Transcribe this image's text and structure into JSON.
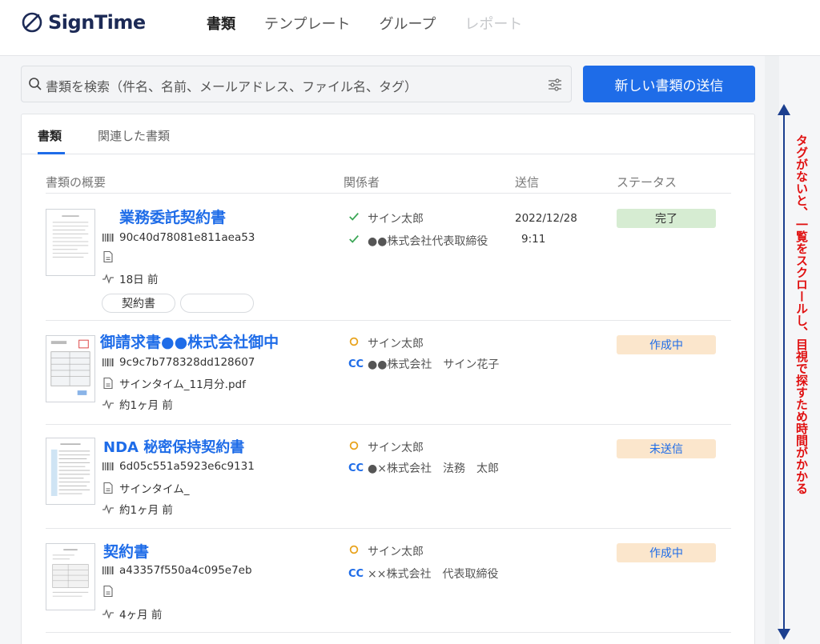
{
  "app": {
    "logo_text": "SignTime"
  },
  "nav": {
    "items": [
      {
        "label": "書類",
        "state": "active"
      },
      {
        "label": "テンプレート",
        "state": "normal"
      },
      {
        "label": "グループ",
        "state": "normal"
      },
      {
        "label": "レポート",
        "state": "disabled"
      }
    ]
  },
  "search": {
    "placeholder": "書類を検索（件名、名前、メールアドレス、ファイル名、タグ）"
  },
  "send_button": {
    "label": "新しい書類の送信"
  },
  "tabs": [
    {
      "label": "書類",
      "active": true
    },
    {
      "label": "関連した書類",
      "active": false
    }
  ],
  "columns": {
    "summary": "書類の概要",
    "parties": "関係者",
    "sent": "送信",
    "status": "ステータス"
  },
  "documents": [
    {
      "title": "業務委託契約書",
      "id": "90c40d78081e811aea53",
      "file": "",
      "activity": "18日 前",
      "tags": [
        "契約書",
        ""
      ],
      "parties": [
        {
          "icon": "check-icon",
          "name": "サイン太郎"
        },
        {
          "icon": "check-icon",
          "name": "●●株式会社代表取締役"
        }
      ],
      "sent_date": "2022/12/28",
      "sent_time": "9:11",
      "status": "完了"
    },
    {
      "title": "御請求書●●株式会社御中",
      "id": "9c9c7b778328dd128607",
      "file": "サインタイム_11月分.pdf",
      "activity": "約1ヶ月 前",
      "tags": [],
      "parties": [
        {
          "icon": "pending-circle-icon",
          "name": "サイン太郎"
        },
        {
          "icon": "CC",
          "name": "●●株式会社　サイン花子"
        }
      ],
      "sent_date": "",
      "sent_time": "",
      "status": "作成中"
    },
    {
      "title": "NDA 秘密保持契約書",
      "id": "6d05c551a5923e6c9131",
      "file": "サインタイム_",
      "activity": "約1ヶ月 前",
      "tags": [],
      "parties": [
        {
          "icon": "pending-circle-icon",
          "name": "サイン太郎"
        },
        {
          "icon": "CC",
          "name": "●×株式会社　法務　太郎"
        }
      ],
      "sent_date": "",
      "sent_time": "",
      "status": "未送信"
    },
    {
      "title": "契約書",
      "id": "a43357f550a4c095e7eb",
      "file": "",
      "activity": "4ヶ月 前",
      "tags": [],
      "parties": [
        {
          "icon": "pending-circle-icon",
          "name": "サイン太郎"
        },
        {
          "icon": "CC",
          "name": "××株式会社　代表取締役"
        }
      ],
      "sent_date": "",
      "sent_time": "",
      "status": "作成中"
    }
  ],
  "annotation": {
    "text": "タグがないと、一覧をスクロールし、目視で探すため時間がかかる"
  },
  "colors": {
    "accent": "#1e6ce8",
    "annotation": "#e01010",
    "status_done": "#d6ecd2",
    "status_pending": "#fbe6cc"
  }
}
